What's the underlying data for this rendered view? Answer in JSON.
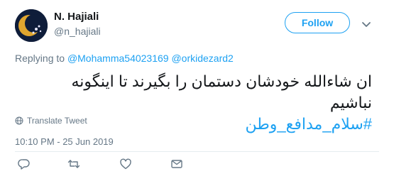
{
  "tweet": {
    "author_name": "N. Hajiali",
    "author_handle": "@n_hajiali",
    "follow_label": "Follow",
    "replying_prefix": "Replying to",
    "replying_to": [
      "@Mohamma54023169",
      "@orkidezard2"
    ],
    "text": "ان شاءالله خودشان دستمان را بگیرند تا اینگونه نباشیم",
    "hashtag": "#سلام_مدافع_وطن",
    "translate_label": "Translate Tweet",
    "timestamp": "10:10 PM - 25 Jun 2019"
  },
  "colors": {
    "accent": "#1da1f2",
    "muted": "#657786",
    "text": "#14171a"
  },
  "icons": [
    "avatar",
    "chevron-down-icon",
    "globe-icon",
    "reply-icon",
    "retweet-icon",
    "like-icon",
    "dm-icon"
  ]
}
